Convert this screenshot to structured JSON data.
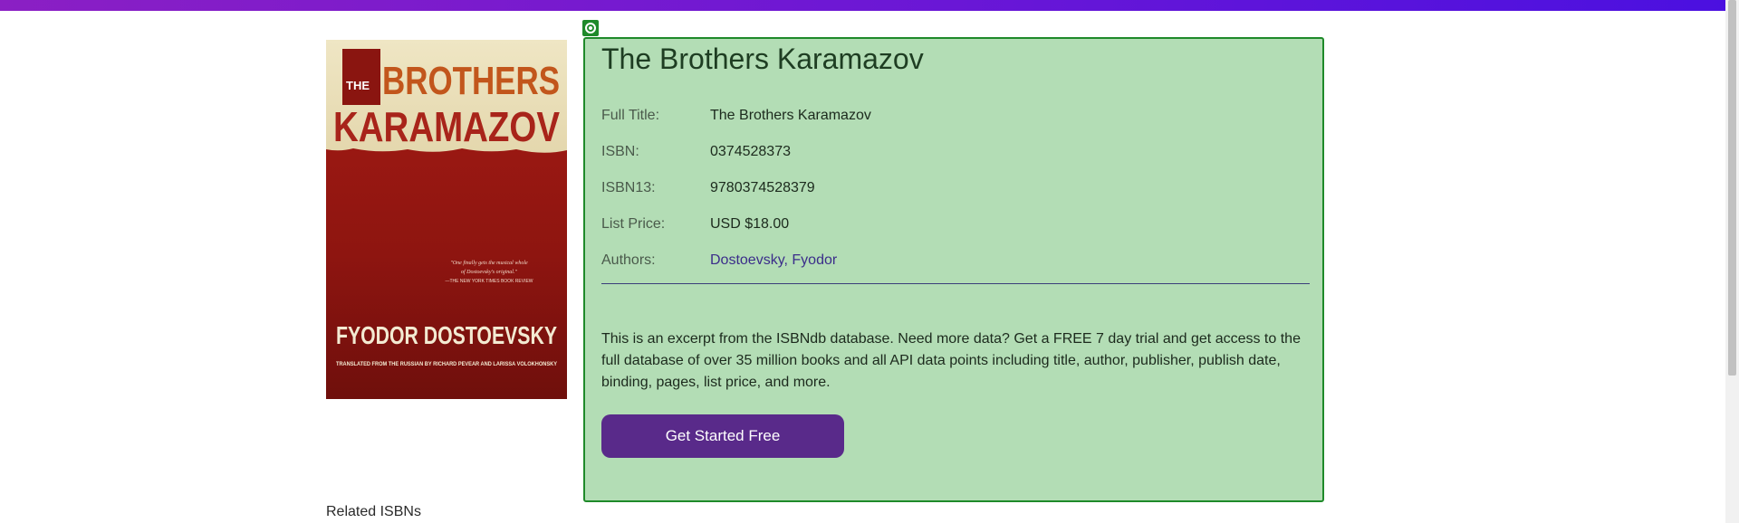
{
  "book": {
    "title": "The Brothers Karamazov",
    "details": [
      {
        "label": "Full Title:",
        "value": "The Brothers Karamazov"
      },
      {
        "label": "ISBN:",
        "value": "0374528373"
      },
      {
        "label": "ISBN13:",
        "value": "9780374528379"
      },
      {
        "label": "List Price:",
        "value": "USD $18.00"
      },
      {
        "label": "Authors:",
        "value": "Dostoevsky, Fyodor"
      }
    ],
    "cover": {
      "the": "THE",
      "title_line1": "BROTHERS",
      "title_line2": "KARAMAZOV",
      "quote_line1": "\"One finally gets the musical whole",
      "quote_line2": "of Dostoevsky's original.\"",
      "quote_source": "—THE NEW YORK TIMES BOOK REVIEW",
      "author": "FYODOR DOSTOEVSKY",
      "translators": "TRANSLATED FROM THE RUSSIAN BY RICHARD PEVEAR AND LARISSA VOLOKHONSKY"
    }
  },
  "promo": {
    "excerpt": "This is an excerpt from the ISBNdb database. Need more data? Get a FREE 7 day trial and get access to the full database of over 35 million books and all API data points including title, author, publisher, publish date, binding, pages, list price, and more.",
    "cta_label": "Get Started Free"
  },
  "related": {
    "heading": "Related ISBNs"
  },
  "colors": {
    "panel_bg": "#b3ddb5",
    "panel_border": "#1f8a2a",
    "cta_bg": "#592a8a",
    "link": "#3b2d8a",
    "topbar": "#6a17d6"
  }
}
